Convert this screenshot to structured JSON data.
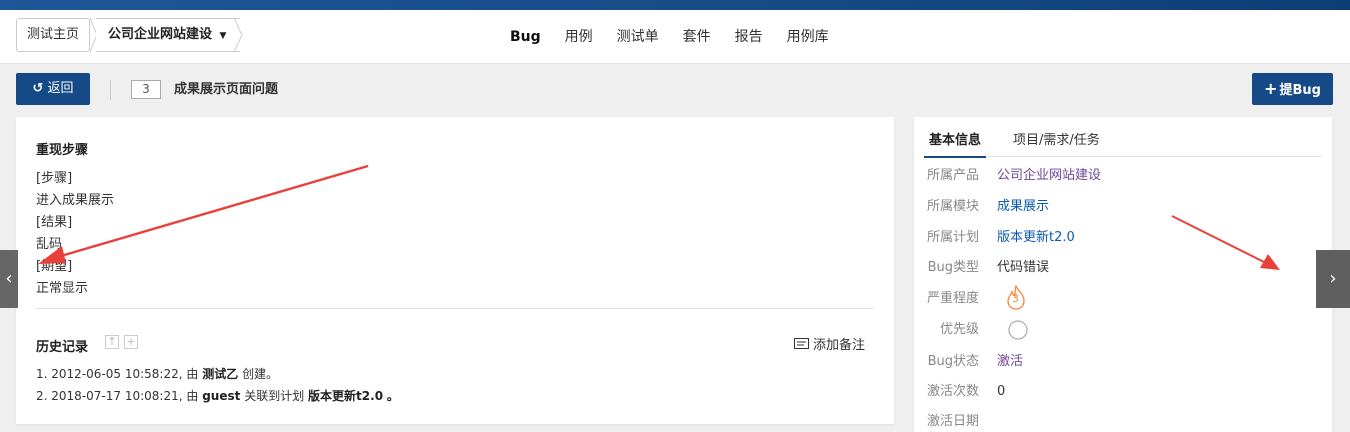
{
  "breadcrumb": {
    "home": "测试主页",
    "product": "公司企业网站建设"
  },
  "nav": {
    "items": [
      "Bug",
      "用例",
      "测试单",
      "套件",
      "报告",
      "用例库"
    ],
    "active": "Bug"
  },
  "toolbar": {
    "back_label": "返回",
    "bug_id": "3",
    "bug_title": "成果展示页面问题",
    "new_bug_label": "提Bug"
  },
  "steps": {
    "title": "重现步骤",
    "lines": [
      "[步骤]",
      "进入成果展示",
      "[结果]",
      "乱码",
      "[期望]",
      "正常显示"
    ]
  },
  "history": {
    "title": "历史记录",
    "add_note": "添加备注",
    "entries": [
      {
        "index": "1.",
        "time": "2012-06-05 10:58:22,",
        "by": "由",
        "user": "测试乙",
        "action": "创建。"
      },
      {
        "index": "2.",
        "time": "2018-07-17 10:08:21,",
        "by": "由",
        "user": "guest",
        "action": "关联到计划",
        "target": "版本更新t2.0",
        "end": "。"
      }
    ]
  },
  "side": {
    "tabs": [
      "基本信息",
      "项目/需求/任务"
    ],
    "fields": [
      {
        "key": "所属产品",
        "value": "公司企业网站建设",
        "style": "purple"
      },
      {
        "key": "所属模块",
        "value": "成果展示",
        "style": "link"
      },
      {
        "key": "所属计划",
        "value": "版本更新t2.0",
        "style": "link"
      },
      {
        "key": "Bug类型",
        "value": "代码错误",
        "style": "plain"
      },
      {
        "key": "严重程度",
        "value": "3",
        "style": "severity"
      },
      {
        "key": "优先级",
        "value": "",
        "style": "priority"
      },
      {
        "key": "Bug状态",
        "value": "激活",
        "style": "purple"
      },
      {
        "key": "激活次数",
        "value": "0",
        "style": "plain"
      },
      {
        "key": "激活日期",
        "value": "",
        "style": "plain"
      }
    ]
  },
  "colors": {
    "primary": "#164a86",
    "link": "#0c5ab0",
    "purple": "#6d4797",
    "annotation_arrow": "#e8413a",
    "severity": "#f0883a"
  }
}
